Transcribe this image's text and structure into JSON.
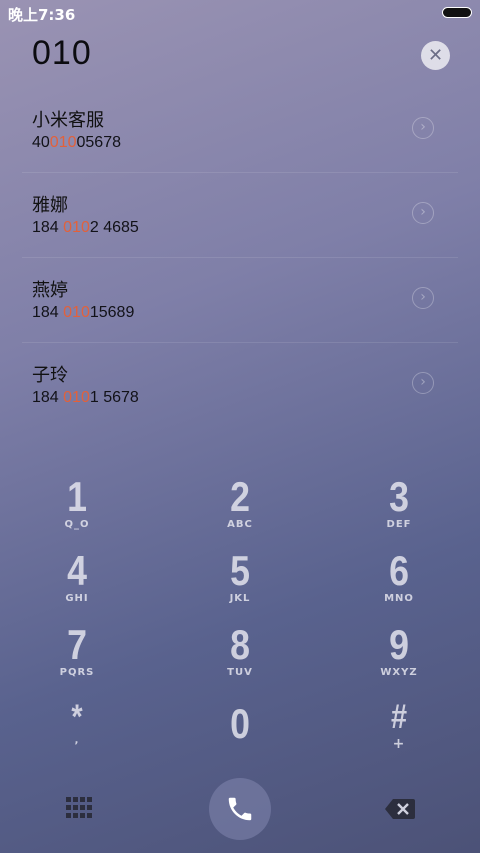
{
  "status_bar": {
    "time": "晚上7:36"
  },
  "dialer": {
    "input": "010"
  },
  "contacts": [
    {
      "name": "小米客服",
      "number_pre": "40",
      "number_match": "010",
      "number_post": "05678"
    },
    {
      "name": "雅娜",
      "number_pre": "184 ",
      "number_match": "010",
      "number_post": "2 4685"
    },
    {
      "name": "燕婷",
      "number_pre": "184 ",
      "number_match": "010",
      "number_post": "15689"
    },
    {
      "name": "子玲",
      "number_pre": "184 ",
      "number_match": "010",
      "number_post": "1 5678"
    }
  ],
  "keypad": [
    {
      "digit": "1",
      "letters": "Q_O"
    },
    {
      "digit": "2",
      "letters": "ABC"
    },
    {
      "digit": "3",
      "letters": "DEF"
    },
    {
      "digit": "4",
      "letters": "GHI"
    },
    {
      "digit": "5",
      "letters": "JKL"
    },
    {
      "digit": "6",
      "letters": "MNO"
    },
    {
      "digit": "7",
      "letters": "PQRS"
    },
    {
      "digit": "8",
      "letters": "TUV"
    },
    {
      "digit": "9",
      "letters": "WXYZ"
    },
    {
      "digit": "*",
      "letters": ","
    },
    {
      "digit": "0",
      "letters": ""
    },
    {
      "digit": "#",
      "letters": "+"
    }
  ],
  "icons": {
    "clear": "close-icon",
    "chevron": "chevron-right-icon",
    "dialpad": "dialpad-grid-icon",
    "call": "phone-icon",
    "backspace": "backspace-icon"
  },
  "colors": {
    "match_highlight": "#e2613b"
  }
}
